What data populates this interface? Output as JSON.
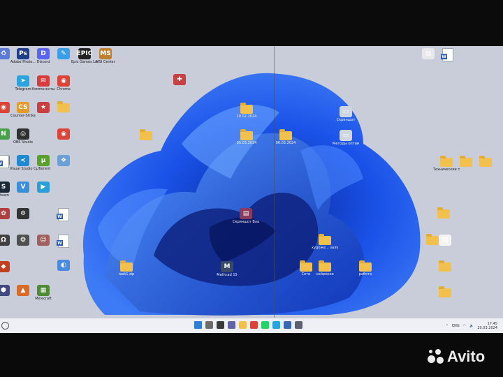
{
  "desktop": {
    "icons": [
      {
        "id": "recycle-bin",
        "label": "",
        "kind": "app",
        "color": "#5a7bd6",
        "glyph": "♻"
      },
      {
        "id": "app-1",
        "label": "Adobe Photo...",
        "kind": "app",
        "color": "#1d3e8a",
        "glyph": "Ps"
      },
      {
        "id": "discord",
        "label": "Discord",
        "kind": "app",
        "color": "#5865f2",
        "glyph": "D"
      },
      {
        "id": "app-3",
        "label": "",
        "kind": "app",
        "color": "#3a9ee8",
        "glyph": "✎"
      },
      {
        "id": "epic-games",
        "label": "Epic Games Launcher",
        "kind": "app",
        "color": "#222222",
        "glyph": "EPIC"
      },
      {
        "id": "app-5",
        "label": "MSI Center",
        "kind": "app",
        "color": "#c08030",
        "glyph": "MS"
      },
      {
        "id": "telegram",
        "label": "Telegram",
        "kind": "app",
        "color": "#2aa3df",
        "glyph": "➤"
      },
      {
        "id": "app-7",
        "label": "Компоненты",
        "kind": "app",
        "color": "#d73c3c",
        "glyph": "✉"
      },
      {
        "id": "chrome-1",
        "label": "Chrome",
        "kind": "app",
        "color": "#db4437",
        "glyph": "◉"
      },
      {
        "id": "chrome-2",
        "label": "",
        "kind": "app",
        "color": "#db4437",
        "glyph": "◉"
      },
      {
        "id": "app-10",
        "label": "Counter-Strike",
        "kind": "app",
        "color": "#e59a2a",
        "glyph": "CS"
      },
      {
        "id": "app-11",
        "label": "",
        "kind": "app",
        "color": "#c94040",
        "glyph": "★"
      },
      {
        "id": "folder-1",
        "label": "",
        "kind": "folder"
      },
      {
        "id": "app-13",
        "label": "",
        "kind": "app",
        "color": "#48a048",
        "glyph": "N"
      },
      {
        "id": "app-14",
        "label": "OBS Studio",
        "kind": "app",
        "color": "#303030",
        "glyph": "◎"
      },
      {
        "id": "app-15",
        "label": "",
        "kind": "app",
        "color": "#4a7ad0",
        "glyph": "▣"
      },
      {
        "id": "chrome-3",
        "label": "",
        "kind": "app",
        "color": "#db4437",
        "glyph": "◉"
      },
      {
        "id": "word-1",
        "label": "",
        "kind": "doc"
      },
      {
        "id": "vscode",
        "label": "Visual Studio Code",
        "kind": "app",
        "color": "#1f8ad2",
        "glyph": "≺"
      },
      {
        "id": "utorrent",
        "label": "µTorrent",
        "kind": "app",
        "color": "#5aa02c",
        "glyph": "µ"
      },
      {
        "id": "app-19",
        "label": "",
        "kind": "app",
        "color": "#6aa0d8",
        "glyph": "❖"
      },
      {
        "id": "steam",
        "label": "Steam",
        "kind": "app",
        "color": "#1b2838",
        "glyph": "S"
      },
      {
        "id": "app-21",
        "label": "",
        "kind": "app",
        "color": "#3a8fd6",
        "glyph": "V"
      },
      {
        "id": "app-22",
        "label": "",
        "kind": "app",
        "color": "#2a9ed6",
        "glyph": "▶"
      },
      {
        "id": "app-23",
        "label": "",
        "kind": "app",
        "color": "#b04040",
        "glyph": "✿"
      },
      {
        "id": "app-24",
        "label": "",
        "kind": "app",
        "color": "#333333",
        "glyph": "⚙"
      },
      {
        "id": "word-2",
        "label": "",
        "kind": "doc"
      },
      {
        "id": "app-26",
        "label": "",
        "kind": "app",
        "color": "#404040",
        "glyph": "Ω"
      },
      {
        "id": "app-27",
        "label": "",
        "kind": "app",
        "color": "#505050",
        "glyph": "❂"
      },
      {
        "id": "app-28",
        "label": "",
        "kind": "app",
        "color": "#a06060",
        "glyph": "☺"
      },
      {
        "id": "word-3",
        "label": "",
        "kind": "doc"
      },
      {
        "id": "app-30",
        "label": "",
        "kind": "app",
        "color": "#c04020",
        "glyph": "◆"
      },
      {
        "id": "app-31",
        "label": "",
        "kind": "app",
        "color": "#4a8ae0",
        "glyph": "◐"
      },
      {
        "id": "app-32",
        "label": "",
        "kind": "app",
        "color": "#404a80",
        "glyph": "⬢"
      },
      {
        "id": "app-33",
        "label": "",
        "kind": "app",
        "color": "#d86a2a",
        "glyph": "▲"
      },
      {
        "id": "minecraft",
        "label": "Minecraft",
        "kind": "app",
        "color": "#4f8a34",
        "glyph": "▦"
      },
      {
        "id": "app-35",
        "label": "",
        "kind": "app",
        "color": "#d04040",
        "glyph": "■"
      },
      {
        "id": "folder-10",
        "label": "10.02.2024",
        "kind": "folder",
        "dark": true
      },
      {
        "id": "folder-05",
        "label": "05.03.2024",
        "kind": "folder",
        "dark": true
      },
      {
        "id": "folder-06",
        "label": "06.03.2024",
        "kind": "folder",
        "dark": true
      },
      {
        "id": "folder-left",
        "label": "",
        "kind": "folder",
        "dark": true
      },
      {
        "id": "app-mid",
        "label": "",
        "kind": "app",
        "color": "#c84040",
        "glyph": "✚",
        "dark": true
      },
      {
        "id": "screenshot-1",
        "label": "Скриншот",
        "kind": "app",
        "color": "#d0d6e0",
        "glyph": "▭",
        "dark": true
      },
      {
        "id": "methods",
        "label": "Методы оптимиза...",
        "kind": "app",
        "color": "#d0d6e0",
        "glyph": "▭",
        "dark": true
      },
      {
        "id": "winrar",
        "label": "Скриншот Владисла...",
        "kind": "app",
        "color": "#8a3a5a",
        "glyph": "▤",
        "dark": true
      },
      {
        "id": "folder-task",
        "label": "task1.zip",
        "kind": "folder",
        "dark": true
      },
      {
        "id": "mathcad",
        "label": "Mathcad 15",
        "kind": "app",
        "color": "#394a66",
        "glyph": "M",
        "dark": true
      },
      {
        "id": "folder-art",
        "label": "художе... залупа...",
        "kind": "folder",
        "dark": true
      },
      {
        "id": "folder-seti",
        "label": "Сети",
        "kind": "folder",
        "dark": true
      },
      {
        "id": "folder-neiro",
        "label": "нейронки",
        "kind": "folder",
        "dark": true
      },
      {
        "id": "folder-rabota",
        "label": "работа",
        "kind": "folder",
        "dark": true
      },
      {
        "id": "right-doc-1",
        "label": "",
        "kind": "app",
        "color": "#e8e8e8",
        "glyph": "▤"
      },
      {
        "id": "right-word",
        "label": "",
        "kind": "doc"
      },
      {
        "id": "right-f1",
        "label": "Технические программы",
        "kind": "folder"
      },
      {
        "id": "right-f2",
        "label": "",
        "kind": "folder"
      },
      {
        "id": "right-f3",
        "label": "",
        "kind": "folder"
      },
      {
        "id": "right-f4",
        "label": "",
        "kind": "folder"
      },
      {
        "id": "right-f5",
        "label": "",
        "kind": "folder"
      },
      {
        "id": "right-doc-2",
        "label": "",
        "kind": "app",
        "color": "#f4f4f4",
        "glyph": "▤"
      },
      {
        "id": "right-f6",
        "label": "",
        "kind": "folder"
      },
      {
        "id": "right-f7",
        "label": "",
        "kind": "folder"
      }
    ]
  },
  "taskbar": {
    "apps": [
      {
        "name": "start-icon",
        "color": "#2f7fd8"
      },
      {
        "name": "search-taskbar-icon",
        "color": "#6c6c6c"
      },
      {
        "name": "task-view-icon",
        "color": "#3a3a3a"
      },
      {
        "name": "chat-icon",
        "color": "#6264a7"
      },
      {
        "name": "file-explorer-icon",
        "color": "#f2c04c"
      },
      {
        "name": "chrome-taskbar-icon",
        "color": "#db4437"
      },
      {
        "name": "whatsapp-icon",
        "color": "#25d366"
      },
      {
        "name": "telegram-taskbar-icon",
        "color": "#2aa3df"
      },
      {
        "name": "app-taskbar-icon",
        "color": "#3a66b8"
      },
      {
        "name": "settings-taskbar-icon",
        "color": "#5c6170"
      }
    ],
    "language": "ENG",
    "time": "17:45",
    "date": "20.03.2024"
  },
  "watermark": {
    "text": "Avito"
  }
}
